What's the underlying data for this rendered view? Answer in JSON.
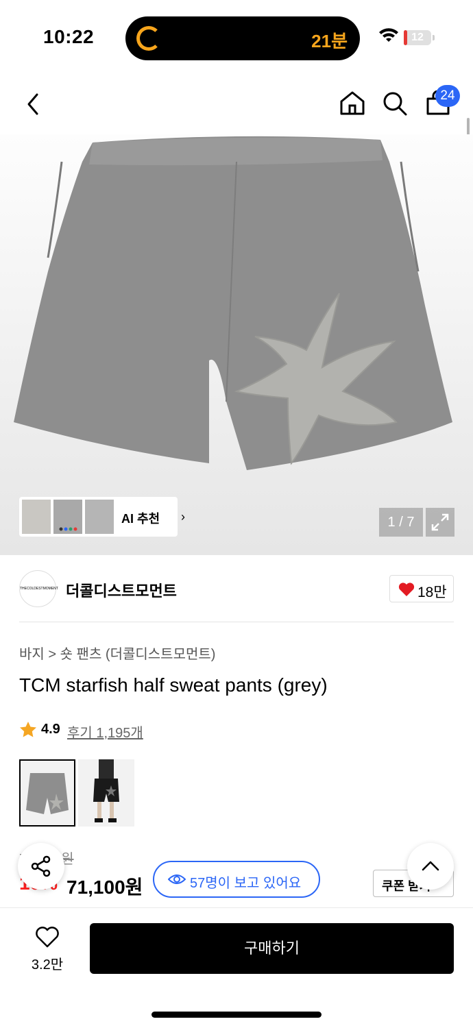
{
  "status_bar": {
    "time": "10:22",
    "activity_text": "21분",
    "battery": "12",
    "battery_level_percent": 12
  },
  "nav": {
    "cart_count": "24",
    "scroll_position_fraction": 0.0
  },
  "gallery": {
    "counter": "1 / 7",
    "ai_recommend_label": "AI 추천",
    "color_dots": [
      "#333333",
      "#2b66f6",
      "#2e9e6a",
      "#e53935"
    ]
  },
  "brand": {
    "name": "더콜디스트모먼트",
    "logo_text": "THECOLDESTMOMENT",
    "likes": "18만"
  },
  "product": {
    "breadcrumb": "바지 > 숏 팬츠 (더콜디스트모먼트)",
    "title": "TCM starfish half sweat pants (grey)",
    "rating": "4.9",
    "reviews": "후기 1,195개",
    "original_price": "79,000원",
    "discount": "10%",
    "price": "71,100원"
  },
  "viewers": "57명이 보고 있어요",
  "coupon": "쿠폰 받기",
  "bottom": {
    "wish_count": "3.2만",
    "buy_label": "구매하기"
  },
  "colors": {
    "accent": "#2b66f6",
    "sale": "#ff2020",
    "activity": "#f7a51c"
  }
}
